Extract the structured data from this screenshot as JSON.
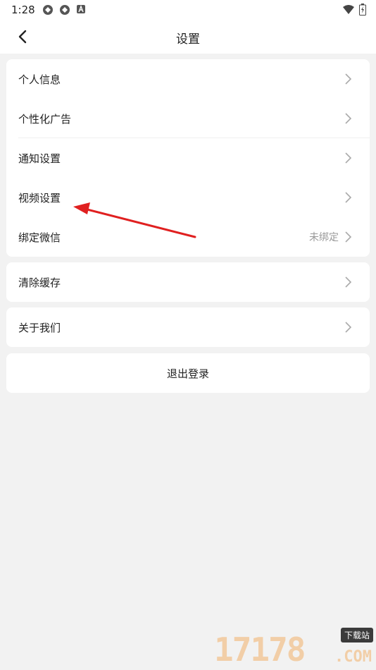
{
  "status_bar": {
    "time": "1:28",
    "left_icons": [
      "sync-icon",
      "sync-icon",
      "font-a-icon"
    ],
    "right_icons": [
      "wifi-icon",
      "battery-charging-icon"
    ]
  },
  "nav": {
    "title": "设置",
    "back_icon": "chevron-left-icon"
  },
  "groups": [
    {
      "items": [
        {
          "label": "个人信息"
        },
        {
          "label": "个性化广告"
        },
        {
          "label": "通知设置"
        },
        {
          "label": "视频设置"
        },
        {
          "label": "绑定微信",
          "value": "未绑定"
        }
      ]
    },
    {
      "items": [
        {
          "label": "清除缓存"
        }
      ]
    },
    {
      "items": [
        {
          "label": "关于我们"
        }
      ]
    }
  ],
  "logout": {
    "label": "退出登录"
  },
  "annotation": {
    "color": "#e02020",
    "icon": "red-arrow-annotation"
  },
  "watermark": {
    "digits": "17178",
    "badge": "下载站",
    "suffix": ".COM"
  },
  "colors": {
    "background": "#f2f2f2",
    "card": "#ffffff",
    "secondary_text": "#999999"
  }
}
